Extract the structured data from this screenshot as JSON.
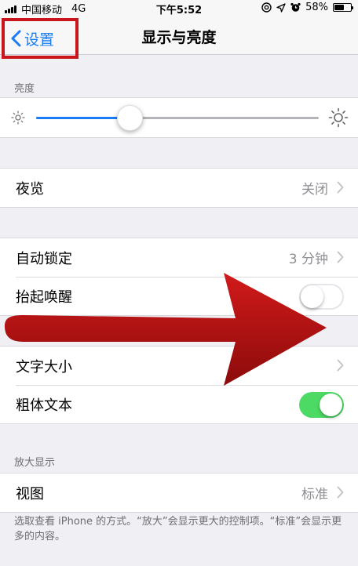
{
  "status_bar": {
    "carrier": "中国移动",
    "network": "4G",
    "time": "下午5:52",
    "battery": "58%",
    "battery_level": 0.58,
    "icons": [
      "signal-icon",
      "at-icon",
      "location-icon",
      "alarm-icon",
      "battery-icon"
    ]
  },
  "nav": {
    "back_label": "设置",
    "title": "显示与亮度"
  },
  "brightness": {
    "header": "亮度",
    "level": 0.33
  },
  "night_shift": {
    "label": "夜览",
    "value": "关闭"
  },
  "lock_group": {
    "auto_lock_label": "自动锁定",
    "auto_lock_value": "3 分钟",
    "raise_to_wake_label": "抬起唤醒",
    "raise_to_wake_on": false
  },
  "text_group": {
    "text_size_label": "文字大小",
    "bold_text_label": "粗体文本",
    "bold_text_on": true
  },
  "zoom": {
    "header": "放大显示",
    "view_label": "视图",
    "view_value": "标准",
    "note": "选取查看 iPhone 的方式。“放大”会显示更大的控制项。“标准”会显示更多的内容。"
  },
  "colors": {
    "accent": "#1a7cf5",
    "switch_on": "#4cd964",
    "annotation": "#c8161d"
  }
}
